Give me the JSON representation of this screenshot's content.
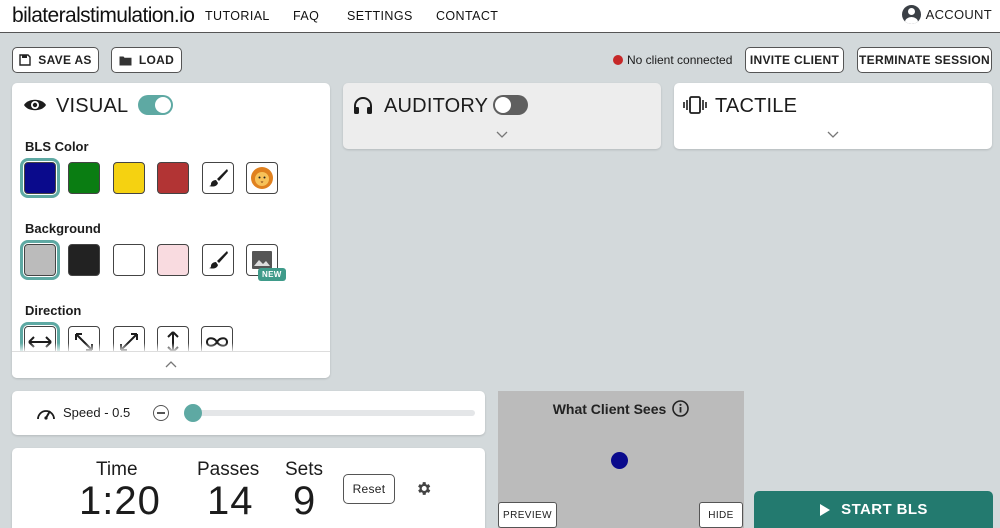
{
  "header": {
    "logo": "bilateralstimulation.io",
    "nav": [
      "TUTORIAL",
      "FAQ",
      "SETTINGS",
      "CONTACT"
    ],
    "account_label": "ACCOUNT"
  },
  "toolbar": {
    "save_as": "SAVE AS",
    "load": "LOAD",
    "status": "No client connected",
    "invite": "INVITE CLIENT",
    "terminate": "TERMINATE SESSION"
  },
  "visual": {
    "title": "VISUAL",
    "enabled": true,
    "bls_color_label": "BLS Color",
    "bls_colors": [
      "#0a0a8c",
      "#0a7d12",
      "#f5d211",
      "#b23434"
    ],
    "bls_selected_index": 0,
    "background_label": "Background",
    "background_colors": [
      "#bbbbbb",
      "#222222",
      "#ffffff",
      "#f9dbe0"
    ],
    "background_selected_index": 0,
    "new_badge": "NEW",
    "direction_label": "Direction"
  },
  "auditory": {
    "title": "AUDITORY",
    "enabled": false
  },
  "tactile": {
    "title": "TACTILE"
  },
  "speed": {
    "label": "Speed - 0.5",
    "value_fraction": 0.0
  },
  "session": {
    "time_label": "Time",
    "time_value": "1:20",
    "passes_label": "Passes",
    "passes_value": "14",
    "sets_label": "Sets",
    "sets_value": "9",
    "reset": "Reset"
  },
  "preview": {
    "title": "What Client Sees",
    "preview_button": "PREVIEW",
    "hide_button": "HIDE",
    "ball_color": "#0a0a8c",
    "background": "#bbbbbb"
  },
  "start_button": "START BLS",
  "colors": {
    "accent": "#5ea9a3",
    "start": "#237a6f",
    "status_red": "#c62828"
  }
}
